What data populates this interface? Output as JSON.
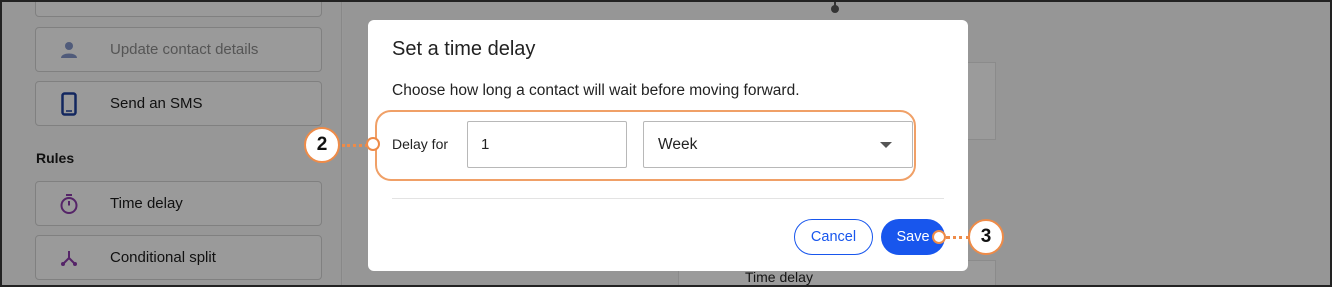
{
  "sidebar": {
    "items": [
      {
        "label": "Update contact details",
        "icon": "person-icon",
        "disabled": true
      },
      {
        "label": "Send an SMS",
        "icon": "phone-icon",
        "disabled": false
      }
    ],
    "rules_title": "Rules",
    "rules": [
      {
        "label": "Time delay",
        "icon": "stopwatch-icon"
      },
      {
        "label": "Conditional split",
        "icon": "split-icon"
      }
    ]
  },
  "canvas": {
    "card_title": "Time delay"
  },
  "modal": {
    "title": "Set a time delay",
    "description": "Choose how long a contact will wait before moving forward.",
    "delay_label": "Delay for",
    "delay_value": "1",
    "unit_selected": "Week",
    "cancel_label": "Cancel",
    "save_label": "Save"
  },
  "callouts": {
    "delay": "2",
    "save": "3"
  },
  "colors": {
    "accent": "#1856ed",
    "callout": "#ee8b48",
    "rule_icon": "#8a3aa8",
    "action_icon": "#1f3f9a"
  }
}
